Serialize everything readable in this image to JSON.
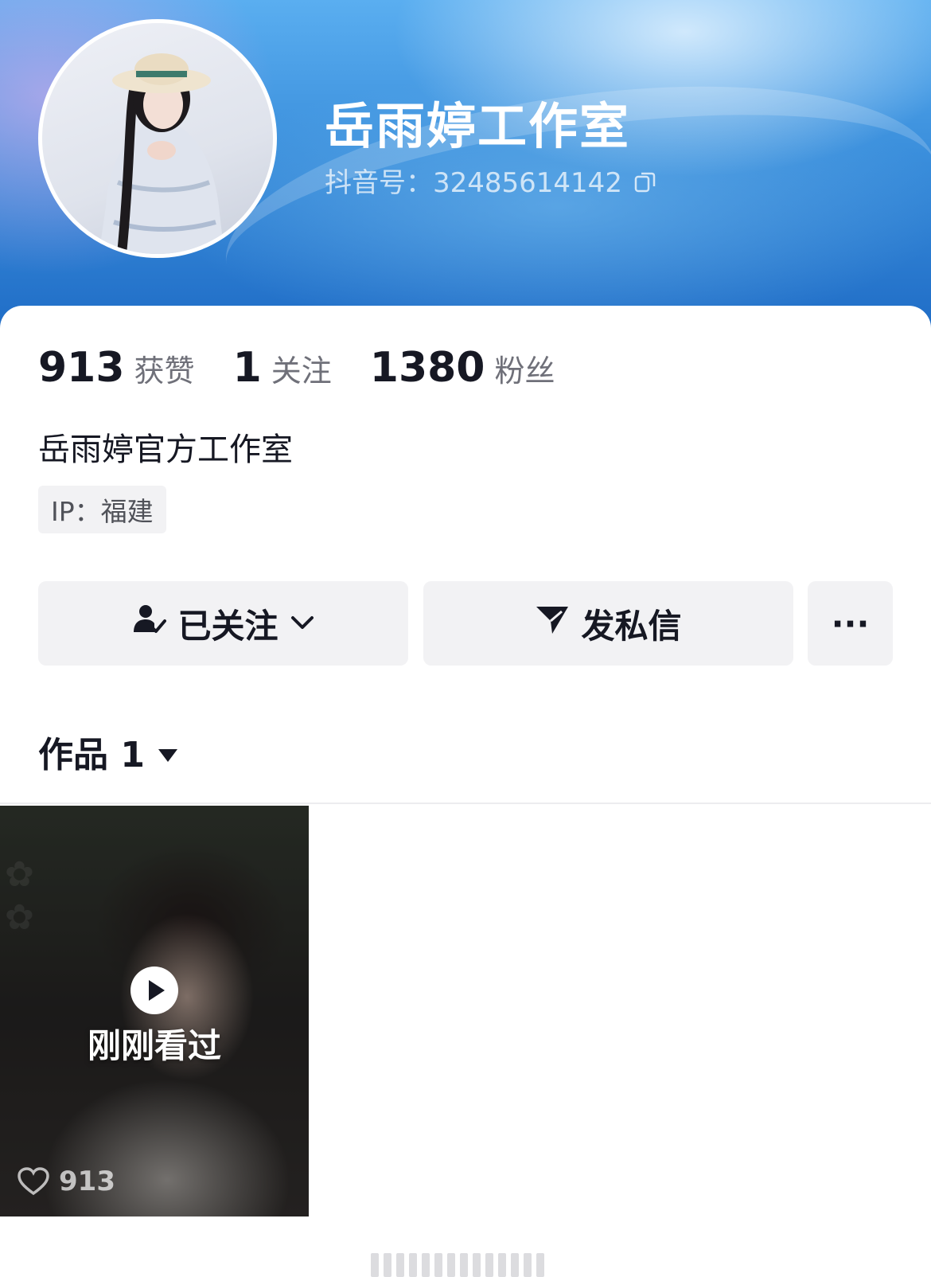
{
  "profile": {
    "nickname": "岳雨婷工作室",
    "douyin_id": "抖音号：32485614142",
    "bio": "岳雨婷官方工作室",
    "ip": "IP：福建"
  },
  "stats": [
    {
      "num": "913",
      "label": "获赞"
    },
    {
      "num": "1",
      "label": "关注"
    },
    {
      "num": "1380",
      "label": "粉丝"
    }
  ],
  "buttons": {
    "follow_label": "已关注",
    "message_label": "发私信",
    "more_label": "···"
  },
  "works": {
    "tab_label": "作品 1"
  },
  "video": {
    "overlay_label": "刚刚看过",
    "likes": "913"
  },
  "icons": {
    "copy": "copy-icon",
    "followed": "user-check-icon",
    "chevron": "chevron-down-icon",
    "send": "send-icon",
    "more": "more-icon",
    "triangle": "triangle-down-icon",
    "play": "play-icon",
    "heart": "heart-icon"
  },
  "colors": {
    "banner_blue": "#1f6cc6",
    "text_primary": "#161823",
    "text_secondary": "#6f7079",
    "button_bg": "#f2f2f4"
  }
}
